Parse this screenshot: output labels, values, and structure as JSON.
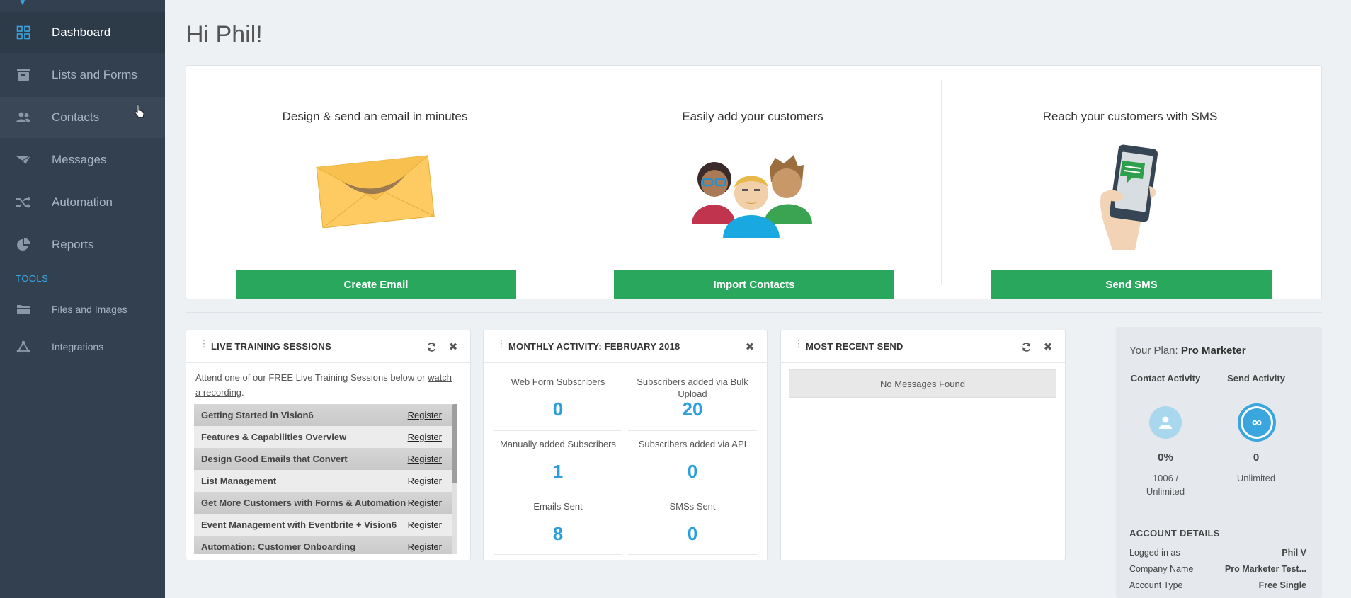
{
  "sidebar": {
    "items": [
      {
        "label": "Dashboard",
        "icon": "dashboard-grid-icon"
      },
      {
        "label": "Lists and Forms",
        "icon": "list-card-icon"
      },
      {
        "label": "Contacts",
        "icon": "contacts-icon"
      },
      {
        "label": "Messages",
        "icon": "paper-plane-icon"
      },
      {
        "label": "Automation",
        "icon": "shuffle-icon"
      },
      {
        "label": "Reports",
        "icon": "pie-chart-icon"
      }
    ],
    "tools_label": "TOOLS",
    "tools": [
      {
        "label": "Files and Images",
        "icon": "folder-icon"
      },
      {
        "label": "Integrations",
        "icon": "integrations-icon"
      }
    ],
    "accent": "#3aa6e0"
  },
  "greeting": "Hi Phil!",
  "hero": [
    {
      "title": "Design & send an email in minutes",
      "button": "Create Email"
    },
    {
      "title": "Easily add your customers",
      "button": "Import Contacts"
    },
    {
      "title": "Reach your customers with SMS",
      "button": "Send SMS"
    }
  ],
  "training": {
    "title": "LIVE TRAINING SESSIONS",
    "intro_before": "Attend one of our FREE Live Training Sessions below or ",
    "intro_link": "watch a recording",
    "intro_after": ".",
    "register_label": "Register",
    "sessions": [
      "Getting Started in Vision6",
      "Features & Capabilities Overview",
      "Design Good Emails that Convert",
      "List Management",
      "Get More Customers with Forms & Automation",
      "Event Management with Eventbrite + Vision6",
      "Automation: Customer Onboarding"
    ]
  },
  "monthly": {
    "title": "MONTHLY ACTIVITY: FEBRUARY 2018",
    "stats": [
      {
        "label": "Web Form Subscribers",
        "value": "0"
      },
      {
        "label": "Subscribers added via Bulk Upload",
        "value": "20"
      },
      {
        "label": "Manually added Subscribers",
        "value": "1"
      },
      {
        "label": "Subscribers added via API",
        "value": "0"
      },
      {
        "label": "Emails Sent",
        "value": "8"
      },
      {
        "label": "SMSs Sent",
        "value": "0"
      }
    ]
  },
  "recent": {
    "title": "MOST RECENT SEND",
    "empty": "No Messages Found"
  },
  "plan": {
    "label": "Your Plan: ",
    "name": "Pro Marketer",
    "contact_activity": {
      "heading": "Contact Activity",
      "value": "0%",
      "line1": "1006 /",
      "line2": "Unlimited"
    },
    "send_activity": {
      "heading": "Send Activity",
      "value": "0",
      "line1": "Unlimited",
      "symbol": "∞"
    },
    "account_details_title": "ACCOUNT DETAILS",
    "details": [
      {
        "key": "Logged in as",
        "value": "Phil V"
      },
      {
        "key": "Company Name",
        "value": "Pro Marketer Test..."
      },
      {
        "key": "Account Type",
        "value": "Free Single"
      }
    ]
  },
  "colors": {
    "button_green": "#29a85d",
    "stat_blue": "#2b9fdc",
    "sidebar_bg": "#33404f"
  }
}
